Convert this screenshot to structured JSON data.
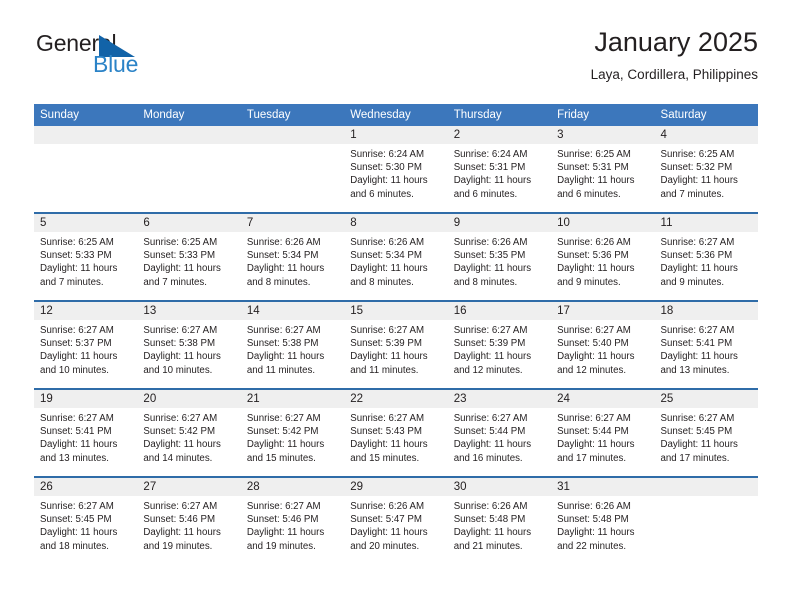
{
  "brand": {
    "name_part1": "General",
    "name_part2": "Blue",
    "flag_icon": "blue-triangle-flag-icon",
    "colors": {
      "dark": "#231f20",
      "blue": "#2b83c7"
    }
  },
  "header": {
    "title": "January 2025",
    "location": "Laya, Cordillera, Philippines"
  },
  "theme": {
    "header_blue": "#3c77bc",
    "row_divider_blue": "#2f6ca8",
    "date_band_gray": "#efefef",
    "text": "#231f20"
  },
  "weekdays": [
    "Sunday",
    "Monday",
    "Tuesday",
    "Wednesday",
    "Thursday",
    "Friday",
    "Saturday"
  ],
  "weeks": [
    [
      {
        "day": "",
        "empty": true,
        "lines": []
      },
      {
        "day": "",
        "empty": true,
        "lines": []
      },
      {
        "day": "",
        "empty": true,
        "lines": []
      },
      {
        "day": "1",
        "empty": false,
        "lines": [
          "Sunrise: 6:24 AM",
          "Sunset: 5:30 PM",
          "Daylight: 11 hours",
          "and 6 minutes."
        ]
      },
      {
        "day": "2",
        "empty": false,
        "lines": [
          "Sunrise: 6:24 AM",
          "Sunset: 5:31 PM",
          "Daylight: 11 hours",
          "and 6 minutes."
        ]
      },
      {
        "day": "3",
        "empty": false,
        "lines": [
          "Sunrise: 6:25 AM",
          "Sunset: 5:31 PM",
          "Daylight: 11 hours",
          "and 6 minutes."
        ]
      },
      {
        "day": "4",
        "empty": false,
        "lines": [
          "Sunrise: 6:25 AM",
          "Sunset: 5:32 PM",
          "Daylight: 11 hours",
          "and 7 minutes."
        ]
      }
    ],
    [
      {
        "day": "5",
        "empty": false,
        "lines": [
          "Sunrise: 6:25 AM",
          "Sunset: 5:33 PM",
          "Daylight: 11 hours",
          "and 7 minutes."
        ]
      },
      {
        "day": "6",
        "empty": false,
        "lines": [
          "Sunrise: 6:25 AM",
          "Sunset: 5:33 PM",
          "Daylight: 11 hours",
          "and 7 minutes."
        ]
      },
      {
        "day": "7",
        "empty": false,
        "lines": [
          "Sunrise: 6:26 AM",
          "Sunset: 5:34 PM",
          "Daylight: 11 hours",
          "and 8 minutes."
        ]
      },
      {
        "day": "8",
        "empty": false,
        "lines": [
          "Sunrise: 6:26 AM",
          "Sunset: 5:34 PM",
          "Daylight: 11 hours",
          "and 8 minutes."
        ]
      },
      {
        "day": "9",
        "empty": false,
        "lines": [
          "Sunrise: 6:26 AM",
          "Sunset: 5:35 PM",
          "Daylight: 11 hours",
          "and 8 minutes."
        ]
      },
      {
        "day": "10",
        "empty": false,
        "lines": [
          "Sunrise: 6:26 AM",
          "Sunset: 5:36 PM",
          "Daylight: 11 hours",
          "and 9 minutes."
        ]
      },
      {
        "day": "11",
        "empty": false,
        "lines": [
          "Sunrise: 6:27 AM",
          "Sunset: 5:36 PM",
          "Daylight: 11 hours",
          "and 9 minutes."
        ]
      }
    ],
    [
      {
        "day": "12",
        "empty": false,
        "lines": [
          "Sunrise: 6:27 AM",
          "Sunset: 5:37 PM",
          "Daylight: 11 hours",
          "and 10 minutes."
        ]
      },
      {
        "day": "13",
        "empty": false,
        "lines": [
          "Sunrise: 6:27 AM",
          "Sunset: 5:38 PM",
          "Daylight: 11 hours",
          "and 10 minutes."
        ]
      },
      {
        "day": "14",
        "empty": false,
        "lines": [
          "Sunrise: 6:27 AM",
          "Sunset: 5:38 PM",
          "Daylight: 11 hours",
          "and 11 minutes."
        ]
      },
      {
        "day": "15",
        "empty": false,
        "lines": [
          "Sunrise: 6:27 AM",
          "Sunset: 5:39 PM",
          "Daylight: 11 hours",
          "and 11 minutes."
        ]
      },
      {
        "day": "16",
        "empty": false,
        "lines": [
          "Sunrise: 6:27 AM",
          "Sunset: 5:39 PM",
          "Daylight: 11 hours",
          "and 12 minutes."
        ]
      },
      {
        "day": "17",
        "empty": false,
        "lines": [
          "Sunrise: 6:27 AM",
          "Sunset: 5:40 PM",
          "Daylight: 11 hours",
          "and 12 minutes."
        ]
      },
      {
        "day": "18",
        "empty": false,
        "lines": [
          "Sunrise: 6:27 AM",
          "Sunset: 5:41 PM",
          "Daylight: 11 hours",
          "and 13 minutes."
        ]
      }
    ],
    [
      {
        "day": "19",
        "empty": false,
        "lines": [
          "Sunrise: 6:27 AM",
          "Sunset: 5:41 PM",
          "Daylight: 11 hours",
          "and 13 minutes."
        ]
      },
      {
        "day": "20",
        "empty": false,
        "lines": [
          "Sunrise: 6:27 AM",
          "Sunset: 5:42 PM",
          "Daylight: 11 hours",
          "and 14 minutes."
        ]
      },
      {
        "day": "21",
        "empty": false,
        "lines": [
          "Sunrise: 6:27 AM",
          "Sunset: 5:42 PM",
          "Daylight: 11 hours",
          "and 15 minutes."
        ]
      },
      {
        "day": "22",
        "empty": false,
        "lines": [
          "Sunrise: 6:27 AM",
          "Sunset: 5:43 PM",
          "Daylight: 11 hours",
          "and 15 minutes."
        ]
      },
      {
        "day": "23",
        "empty": false,
        "lines": [
          "Sunrise: 6:27 AM",
          "Sunset: 5:44 PM",
          "Daylight: 11 hours",
          "and 16 minutes."
        ]
      },
      {
        "day": "24",
        "empty": false,
        "lines": [
          "Sunrise: 6:27 AM",
          "Sunset: 5:44 PM",
          "Daylight: 11 hours",
          "and 17 minutes."
        ]
      },
      {
        "day": "25",
        "empty": false,
        "lines": [
          "Sunrise: 6:27 AM",
          "Sunset: 5:45 PM",
          "Daylight: 11 hours",
          "and 17 minutes."
        ]
      }
    ],
    [
      {
        "day": "26",
        "empty": false,
        "lines": [
          "Sunrise: 6:27 AM",
          "Sunset: 5:45 PM",
          "Daylight: 11 hours",
          "and 18 minutes."
        ]
      },
      {
        "day": "27",
        "empty": false,
        "lines": [
          "Sunrise: 6:27 AM",
          "Sunset: 5:46 PM",
          "Daylight: 11 hours",
          "and 19 minutes."
        ]
      },
      {
        "day": "28",
        "empty": false,
        "lines": [
          "Sunrise: 6:27 AM",
          "Sunset: 5:46 PM",
          "Daylight: 11 hours",
          "and 19 minutes."
        ]
      },
      {
        "day": "29",
        "empty": false,
        "lines": [
          "Sunrise: 6:26 AM",
          "Sunset: 5:47 PM",
          "Daylight: 11 hours",
          "and 20 minutes."
        ]
      },
      {
        "day": "30",
        "empty": false,
        "lines": [
          "Sunrise: 6:26 AM",
          "Sunset: 5:48 PM",
          "Daylight: 11 hours",
          "and 21 minutes."
        ]
      },
      {
        "day": "31",
        "empty": false,
        "lines": [
          "Sunrise: 6:26 AM",
          "Sunset: 5:48 PM",
          "Daylight: 11 hours",
          "and 22 minutes."
        ]
      },
      {
        "day": "",
        "empty": true,
        "lines": []
      }
    ]
  ]
}
